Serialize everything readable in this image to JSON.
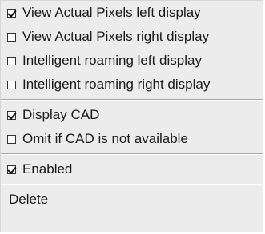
{
  "menu": {
    "items": [
      {
        "label": "View Actual Pixels left display",
        "checked": true
      },
      {
        "label": "View Actual Pixels right display",
        "checked": false
      },
      {
        "label": "Intelligent roaming left display",
        "checked": false
      },
      {
        "label": "Intelligent roaming right display",
        "checked": false
      },
      {
        "label": "Display CAD",
        "checked": true
      },
      {
        "label": "Omit if CAD is not available",
        "checked": false
      },
      {
        "label": "Enabled",
        "checked": true
      },
      {
        "label": "Delete"
      }
    ]
  }
}
